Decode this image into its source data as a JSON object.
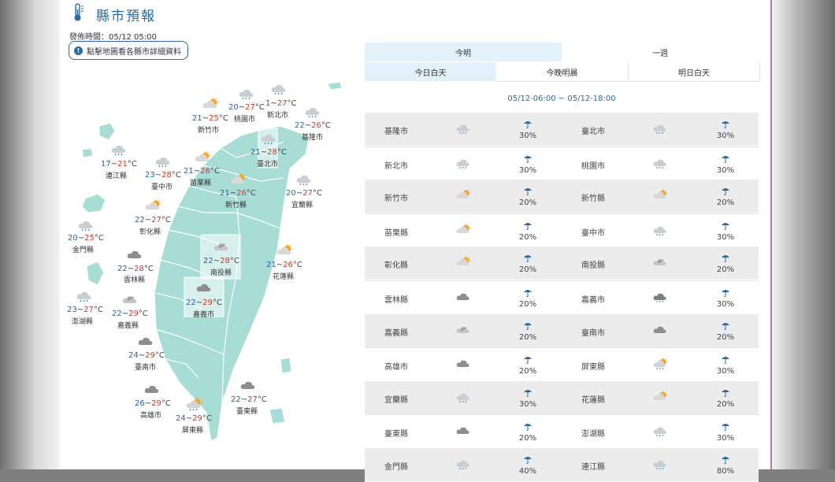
{
  "page": {
    "title": "縣市預報",
    "issued": "發佈時間：05/12 05:00",
    "hint": "點擊地圖看各縣市詳細資料"
  },
  "tabs": {
    "top": [
      "今明",
      "一週"
    ],
    "sub": [
      "今日白天",
      "今晚明晨",
      "明日白天"
    ],
    "active_top": 0,
    "active_sub": 0
  },
  "time_range": "05/12-06:00 ~ 05/12-18:00",
  "colors": {
    "accent": "#2d6aa1",
    "map": "#a7ddd4",
    "tab_active": "#e3f1fb",
    "low_temp": "#2a62b3",
    "high_temp": "#d0392b"
  },
  "map_labels": [
    {
      "name": "新竹市",
      "lo": "21",
      "hi": "25",
      "icon": "sun-cloud-icon"
    },
    {
      "name": "桃園市",
      "lo": "20",
      "hi": "27",
      "icon": "cloud-rain-icon"
    },
    {
      "name": "新北市",
      "lo": "1",
      "hi": "27",
      "icon": "cloud-rain-icon"
    },
    {
      "name": "基隆市",
      "lo": "22",
      "hi": "26",
      "icon": "cloud-rain-icon"
    },
    {
      "name": "臺北市",
      "lo": "21",
      "hi": "28",
      "icon": "cloud-rain-icon"
    },
    {
      "name": "連江縣",
      "lo": "17",
      "hi": "21",
      "icon": "cloud-rain-icon"
    },
    {
      "name": "臺中市",
      "lo": "23",
      "hi": "28",
      "icon": "cloud-rain-icon"
    },
    {
      "name": "苗栗縣",
      "lo": "21",
      "hi": "26",
      "icon": "sun-cloud-icon"
    },
    {
      "name": "新竹縣",
      "lo": "21",
      "hi": "26",
      "icon": "sun-cloud-icon"
    },
    {
      "name": "宜蘭縣",
      "lo": "20",
      "hi": "27",
      "icon": "cloud-rain-icon"
    },
    {
      "name": "彰化縣",
      "lo": "22",
      "hi": "27",
      "icon": "sun-cloud-icon"
    },
    {
      "name": "金門縣",
      "lo": "20",
      "hi": "25",
      "icon": "cloud-rain-icon"
    },
    {
      "name": "南投縣",
      "lo": "22",
      "hi": "28",
      "icon": "cloud-icon"
    },
    {
      "name": "花蓮縣",
      "lo": "21",
      "hi": "26",
      "icon": "sun-cloud-icon"
    },
    {
      "name": "雲林縣",
      "lo": "22",
      "hi": "28",
      "icon": "dark-cloud-icon"
    },
    {
      "name": "嘉義市",
      "lo": "22",
      "hi": "29",
      "icon": "dark-cloud-icon"
    },
    {
      "name": "澎湖縣",
      "lo": "23",
      "hi": "27",
      "icon": "cloud-rain-icon"
    },
    {
      "name": "嘉義縣",
      "lo": "22",
      "hi": "29",
      "icon": "cloud-icon"
    },
    {
      "name": "臺南市",
      "lo": "24",
      "hi": "29",
      "icon": "dark-cloud-icon"
    },
    {
      "name": "高雄市",
      "lo": "26",
      "hi": "29",
      "icon": "dark-cloud-icon"
    },
    {
      "name": "臺東縣",
      "lo": "22",
      "hi": "27",
      "icon": "dark-cloud-icon"
    },
    {
      "name": "屏東縣",
      "lo": "24",
      "hi": "29",
      "icon": "sun-rain-icon"
    }
  ],
  "table": [
    {
      "left": {
        "name": "基隆市",
        "pop": "30%",
        "icon": "cloud-rain-icon"
      },
      "right": {
        "name": "臺北市",
        "pop": "30%",
        "icon": "cloud-rain-icon"
      }
    },
    {
      "left": {
        "name": "新北市",
        "pop": "30%",
        "icon": "cloud-rain-icon"
      },
      "right": {
        "name": "桃園市",
        "pop": "30%",
        "icon": "cloud-rain-icon"
      }
    },
    {
      "left": {
        "name": "新竹市",
        "pop": "20%",
        "icon": "sun-cloud-icon"
      },
      "right": {
        "name": "新竹縣",
        "pop": "20%",
        "icon": "sun-cloud-icon"
      }
    },
    {
      "left": {
        "name": "苗栗縣",
        "pop": "20%",
        "icon": "sun-cloud-icon"
      },
      "right": {
        "name": "臺中市",
        "pop": "30%",
        "icon": "cloud-rain-icon"
      }
    },
    {
      "left": {
        "name": "彰化縣",
        "pop": "20%",
        "icon": "sun-cloud-icon"
      },
      "right": {
        "name": "南投縣",
        "pop": "20%",
        "icon": "cloud-icon"
      }
    },
    {
      "left": {
        "name": "雲林縣",
        "pop": "20%",
        "icon": "dark-cloud-icon"
      },
      "right": {
        "name": "嘉義市",
        "pop": "30%",
        "icon": "dark-cloud-rain-icon"
      }
    },
    {
      "left": {
        "name": "嘉義縣",
        "pop": "20%",
        "icon": "cloud-icon"
      },
      "right": {
        "name": "臺南市",
        "pop": "20%",
        "icon": "dark-cloud-icon"
      }
    },
    {
      "left": {
        "name": "高雄市",
        "pop": "20%",
        "icon": "dark-cloud-icon"
      },
      "right": {
        "name": "屏東縣",
        "pop": "30%",
        "icon": "sun-rain-icon"
      }
    },
    {
      "left": {
        "name": "宜蘭縣",
        "pop": "30%",
        "icon": "cloud-rain-icon"
      },
      "right": {
        "name": "花蓮縣",
        "pop": "20%",
        "icon": "sun-cloud-icon"
      }
    },
    {
      "left": {
        "name": "臺東縣",
        "pop": "20%",
        "icon": "dark-cloud-icon"
      },
      "right": {
        "name": "澎湖縣",
        "pop": "30%",
        "icon": "cloud-rain-icon"
      }
    },
    {
      "left": {
        "name": "金門縣",
        "pop": "40%",
        "icon": "cloud-rain-icon"
      },
      "right": {
        "name": "連江縣",
        "pop": "80%",
        "icon": "cloud-rain-icon"
      }
    }
  ]
}
